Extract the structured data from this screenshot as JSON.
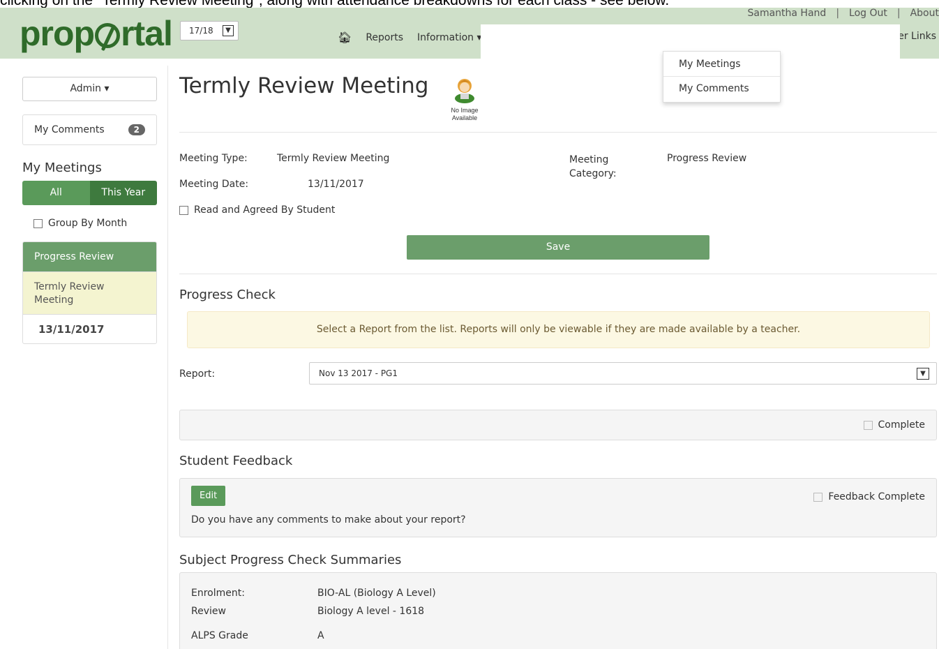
{
  "caption": {
    "text": "clicking on the \"Termly Review Meeting\", along with attendance breakdowns for each class - see below."
  },
  "header": {
    "year": "17/18",
    "nav": {
      "reports": "Reports",
      "information": "Information"
    },
    "user_name": "Samantha Hand",
    "logout": "Log Out",
    "about": "About",
    "other_links": "er Links"
  },
  "dropdown": {
    "items": [
      "My Meetings",
      "My Comments"
    ]
  },
  "sidebar": {
    "admin": "Admin",
    "my_comments": "My Comments",
    "comments_count": "2",
    "heading": "My Meetings",
    "toggle_all": "All",
    "toggle_year": "This Year",
    "group_by_month": "Group By Month",
    "category": "Progress Review",
    "meeting_item": "Termly Review Meeting",
    "meeting_date": "13/11/2017"
  },
  "main": {
    "title": "Termly Review Meeting",
    "no_image": "No Image Available",
    "meeting_type_label": "Meeting Type:",
    "meeting_type": "Termly Review Meeting",
    "meeting_date_label": "Meeting Date:",
    "meeting_date": "13/11/2017",
    "meeting_category_label": "Meeting Category:",
    "meeting_category": "Progress Review",
    "read_agreed": "Read and Agreed By Student",
    "save": "Save",
    "progress_check_title": "Progress Check",
    "alert": "Select a Report from the list. Reports will only be viewable if they are made available by a teacher.",
    "report_label": "Report:",
    "report_value": "Nov 13 2017 - PG1",
    "complete": "Complete",
    "student_feedback_title": "Student Feedback",
    "edit": "Edit",
    "feedback_complete": "Feedback Complete",
    "feedback_question": "Do you have any comments to make about your report?",
    "summaries_title": "Subject Progress Check Summaries",
    "enrolment_label": "Enrolment:",
    "enrolment": "BIO-AL (Biology A Level)",
    "review_label": "Review",
    "review": "Biology A level - 1618",
    "alps_label": "ALPS Grade",
    "alps": "A"
  }
}
